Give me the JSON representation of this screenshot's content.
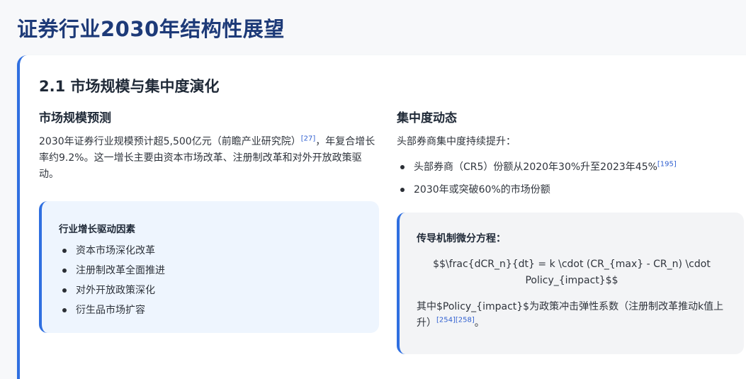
{
  "page": {
    "title": "证券行业2030年结构性展望"
  },
  "section": {
    "title": "2.1 市场规模与集中度演化",
    "left": {
      "heading": "市场规模预测",
      "paragraph_part1": "2030年证券行业规模预计超5,500亿元（前瞻产业研究院）",
      "paragraph_ref": "[27]",
      "paragraph_part2": "，年复合增长率约9.2%。这一增长主要由资本市场改革、注册制改革和对外开放政策驱动。",
      "box": {
        "title": "行业增长驱动因素",
        "items": [
          "资本市场深化改革",
          "注册制改革全面推进",
          "对外开放政策深化",
          "衍生品市场扩容"
        ]
      }
    },
    "right": {
      "heading": "集中度动态",
      "intro": "头部券商集中度持续提升：",
      "items": [
        {
          "text": "头部券商（CR5）份额从2020年30%升至2023年45%",
          "ref": "[195]"
        },
        {
          "text": "2030年或突破60%的市场份额",
          "ref": ""
        }
      ],
      "formula_box": {
        "title": "传导机制微分方程：",
        "formula": "$$\\frac{dCR_n}{dt} = k \\cdot (CR_{max} - CR_n) \\cdot Policy_{impact}$$",
        "note": "其中$Policy_{impact}$为政策冲击弹性系数（注册制改革推动k值上升）",
        "note_refs": "[254][258]",
        "note_end": "。"
      }
    }
  }
}
